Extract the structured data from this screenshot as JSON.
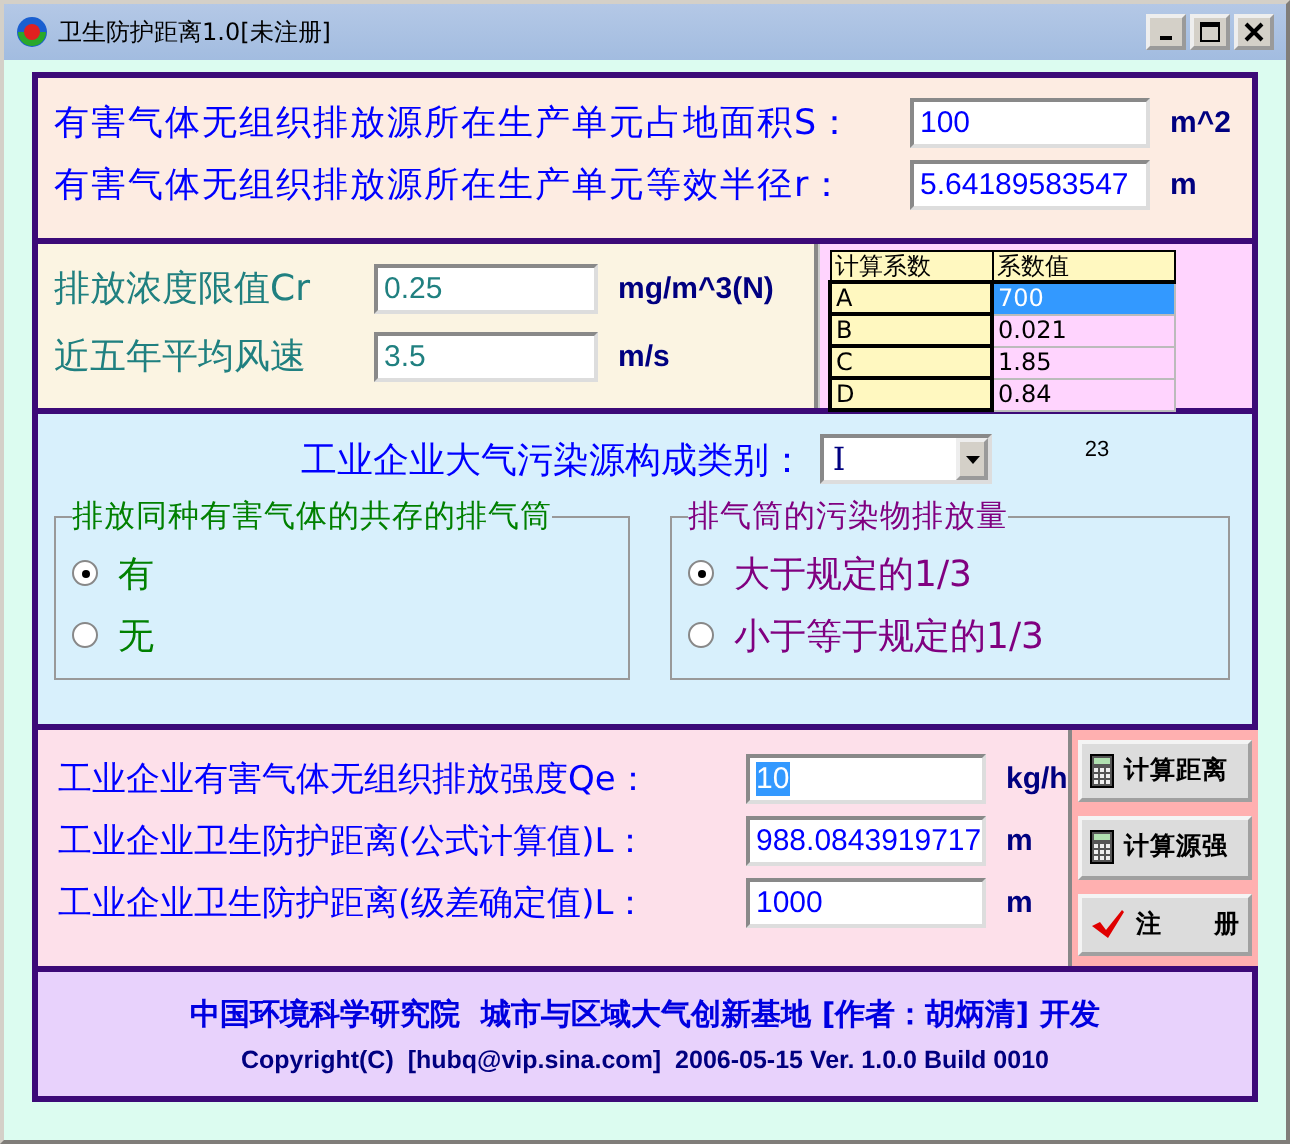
{
  "window": {
    "title": "卫生防护距离1.0[未注册]"
  },
  "area_section": {
    "rows": [
      {
        "label": "有害气体无组织排放源所在生产单元占地面积S：",
        "value": "100",
        "unit": "m^2"
      },
      {
        "label": "有害气体无组织排放源所在生产单元等效半径r：",
        "value": "5.64189583547",
        "unit": "m"
      }
    ]
  },
  "concentration_section": {
    "rows": [
      {
        "label": "排放浓度限值Cr",
        "value": "0.25",
        "unit": "mg/m^3(N)"
      },
      {
        "label": "近五年平均风速",
        "value": "3.5",
        "unit": "m/s"
      }
    ]
  },
  "coefficients": {
    "columns": [
      "计算系数",
      "系数值"
    ],
    "rows": [
      {
        "name": "A",
        "value": "700",
        "selected": true
      },
      {
        "name": "B",
        "value": "0.021",
        "selected": false
      },
      {
        "name": "C",
        "value": "1.85",
        "selected": false
      },
      {
        "name": "D",
        "value": "0.84",
        "selected": false
      }
    ]
  },
  "source_type": {
    "label": "工业企业大气污染源构成类别：",
    "value": "Ⅰ",
    "note": "23"
  },
  "groups": [
    {
      "title": "排放同种有害气体的共存的排气筒",
      "color": "#008000",
      "options": [
        {
          "label": "有",
          "selected": true
        },
        {
          "label": "无",
          "selected": false
        }
      ]
    },
    {
      "title": "排气筒的污染物排放量",
      "color": "#800080",
      "options": [
        {
          "label": "大于规定的1/3",
          "selected": true
        },
        {
          "label": "小于等于规定的1/3",
          "selected": false
        }
      ]
    }
  ],
  "results": {
    "rows": [
      {
        "label": "工业企业有害气体无组织排放强度Qe：",
        "value": "10",
        "unit": "kg/h",
        "selected": true
      },
      {
        "label": "工业企业卫生防护距离(公式计算值)L：",
        "value": "988.0843919717",
        "unit": "m",
        "selected": false
      },
      {
        "label": "工业企业卫生防护距离(级差确定值)L：",
        "value": "1000",
        "unit": "m",
        "selected": false
      }
    ]
  },
  "buttons": [
    {
      "label": "计算距离",
      "kind": "calculator"
    },
    {
      "label": "计算源强",
      "kind": "calculator"
    },
    {
      "label": "注　　册",
      "kind": "check"
    }
  ],
  "footer": {
    "lines": [
      "中国环境科学研究院  城市与区域大气创新基地 [作者：胡炳清] 开发",
      "Copyright(C)  [hubq@vip.sina.com]  2006-05-15 Ver. 1.0.0 Build 0010"
    ]
  }
}
